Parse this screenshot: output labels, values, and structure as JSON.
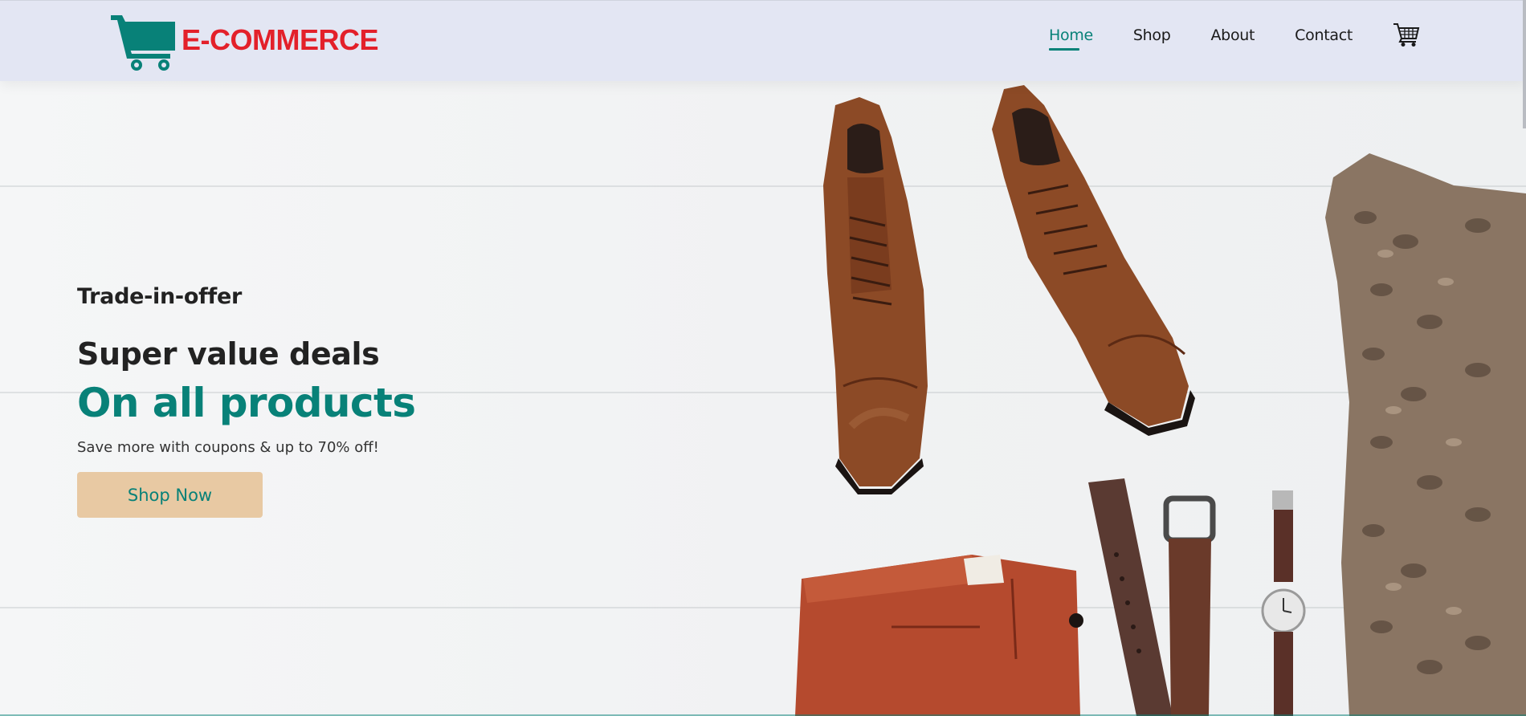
{
  "brand": {
    "name": "E-COMMERCE",
    "accent_color": "#088178",
    "logo_text_color": "#e3202a"
  },
  "nav": {
    "items": [
      {
        "label": "Home",
        "active": true
      },
      {
        "label": "Shop",
        "active": false
      },
      {
        "label": "About",
        "active": false
      },
      {
        "label": "Contact",
        "active": false
      }
    ],
    "cart_icon": "shopping-cart-icon"
  },
  "hero": {
    "sub_title": "Trade-in-offer",
    "headline": "Super value deals",
    "headline_accent": "On all products",
    "tagline": "Save more with coupons & up to 70% off!",
    "cta_label": "Shop Now",
    "cta_color": "#e8c9a3",
    "image_items": [
      "leather-boots",
      "knit-sweater",
      "chino-pants",
      "leather-belt",
      "wristwatch"
    ]
  }
}
